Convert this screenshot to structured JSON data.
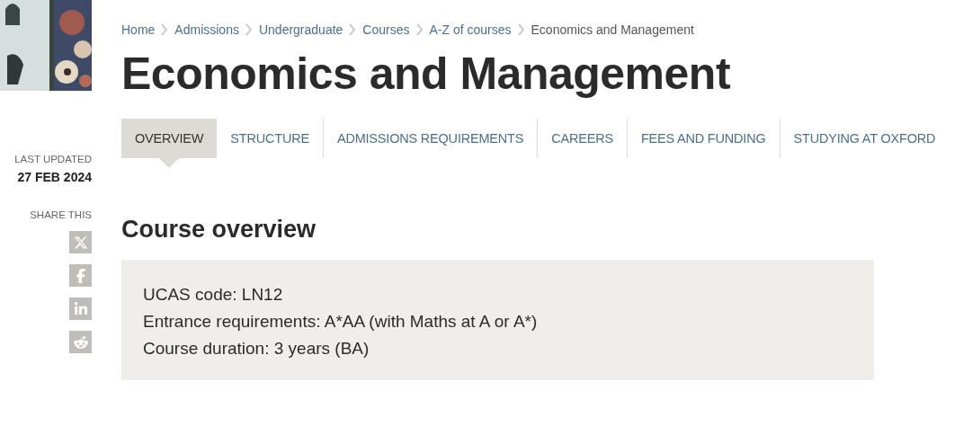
{
  "sidebar": {
    "last_updated_label": "LAST UPDATED",
    "last_updated": "27 FEB 2024",
    "share_label": "SHARE THIS",
    "share_links": [
      {
        "kind": "x"
      },
      {
        "kind": "facebook"
      },
      {
        "kind": "linkedin"
      },
      {
        "kind": "reddit"
      }
    ]
  },
  "breadcrumb": [
    {
      "label": "Home",
      "current": false
    },
    {
      "label": "Admissions",
      "current": false
    },
    {
      "label": "Undergraduate",
      "current": false
    },
    {
      "label": "Courses",
      "current": false
    },
    {
      "label": "A-Z of courses",
      "current": false
    },
    {
      "label": "Economics and Management",
      "current": true
    }
  ],
  "title": "Economics and Management",
  "tabs": [
    {
      "label": "OVERVIEW",
      "selected": true
    },
    {
      "label": "STRUCTURE",
      "selected": false
    },
    {
      "label": "ADMISSIONS REQUIREMENTS",
      "selected": false
    },
    {
      "label": "CAREERS",
      "selected": false
    },
    {
      "label": "FEES AND FUNDING",
      "selected": false
    },
    {
      "label": "STUDYING AT OXFORD",
      "selected": false
    }
  ],
  "section_heading": "Course overview",
  "overview_box": [
    "UCAS code: LN12",
    "Entrance requirements: A*AA (with Maths at A or A*)",
    "Course duration: 3 years (BA)"
  ]
}
